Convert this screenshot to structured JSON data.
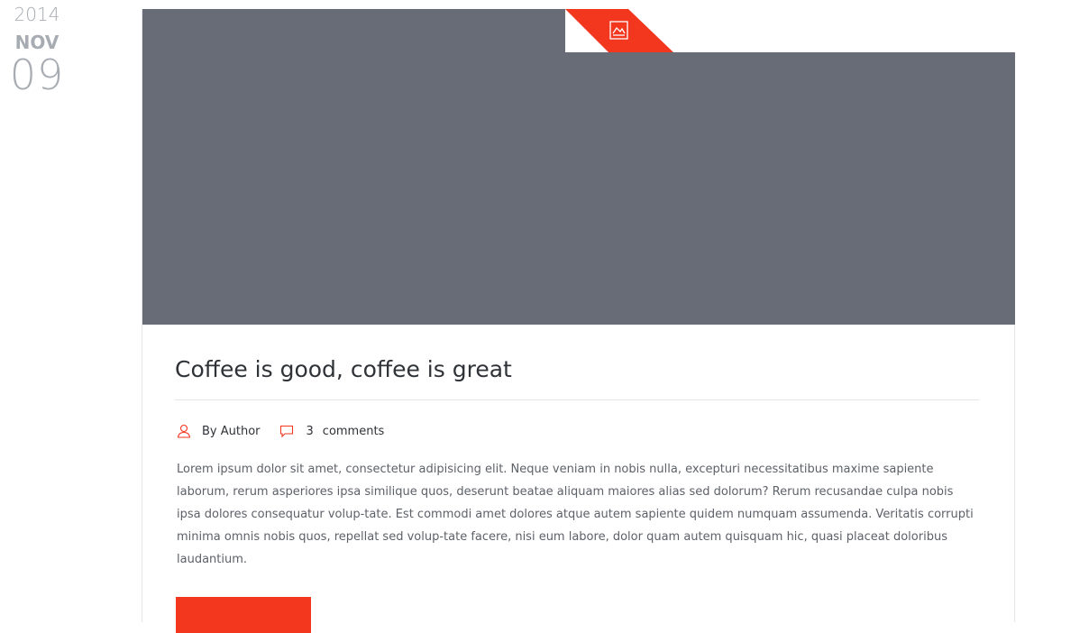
{
  "date": {
    "year": "2014",
    "month": "NOV",
    "day": "09"
  },
  "post": {
    "format_icon": "image-icon",
    "title": "Coffee is good, coffee is great",
    "author": "By Author",
    "comments_count": "3",
    "comments_label": "comments",
    "excerpt": "Lorem ipsum dolor sit amet, consectetur adipisicing elit. Neque veniam in nobis nulla, excepturi necessitatibus maxime sapiente laborum, rerum asperiores ipsa similique quos, deserunt beatae aliquam maiores alias sed dolorum? Rerum recusandae culpa nobis ipsa dolores consequatur volup-tate. Est commodi amet dolores atque autem sapiente quidem numquam assumenda. Veritatis corrupti minima omnis nobis quos, repellat sed volup-tate facere, nisi eum labore, dolor quam autem quisquam hic, quasi placeat doloribus laudantium."
  },
  "colors": {
    "accent": "#f3361e",
    "media_placeholder": "#676c77",
    "date_text": "#a7abb2",
    "title_text": "#2f3237",
    "body_text": "#5d6168"
  }
}
